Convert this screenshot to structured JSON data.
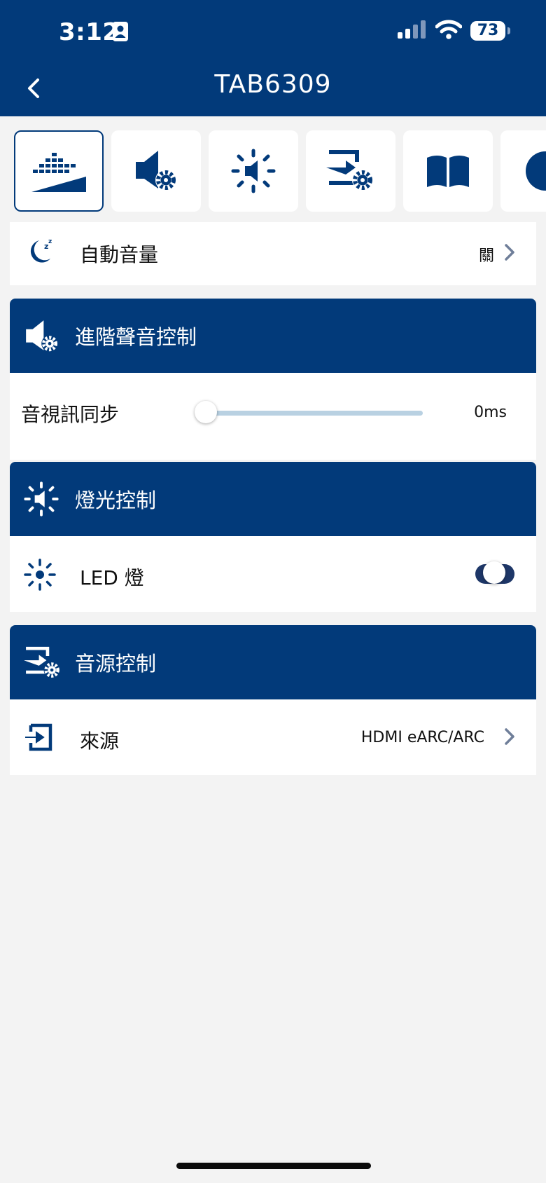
{
  "status_bar": {
    "time": "3:12",
    "battery": "73"
  },
  "header": {
    "title": "TAB6309"
  },
  "tabs": [
    {
      "icon": "equalizer-volume-icon",
      "active": true
    },
    {
      "icon": "speaker-gear-icon",
      "active": false
    },
    {
      "icon": "light-speaker-icon",
      "active": false
    },
    {
      "icon": "input-gear-icon",
      "active": false
    },
    {
      "icon": "book-icon",
      "active": false
    },
    {
      "icon": "info-icon",
      "active": false
    }
  ],
  "auto_volume": {
    "label": "自動音量",
    "value": "關"
  },
  "advanced_sound": {
    "title": "進階聲音控制",
    "av_sync": {
      "label": "音視訊同步",
      "value": "0ms",
      "level": 0
    }
  },
  "light_control": {
    "title": "燈光控制",
    "led": {
      "label": "LED 燈",
      "on": true
    }
  },
  "source_control": {
    "title": "音源控制",
    "source": {
      "label": "來源",
      "value": "HDMI eARC/ARC"
    }
  },
  "colors": {
    "brand": "#023a7a",
    "background": "#f3f3f3",
    "slider_track": "#b9d1e2",
    "toggle_on": "#1e3768"
  }
}
